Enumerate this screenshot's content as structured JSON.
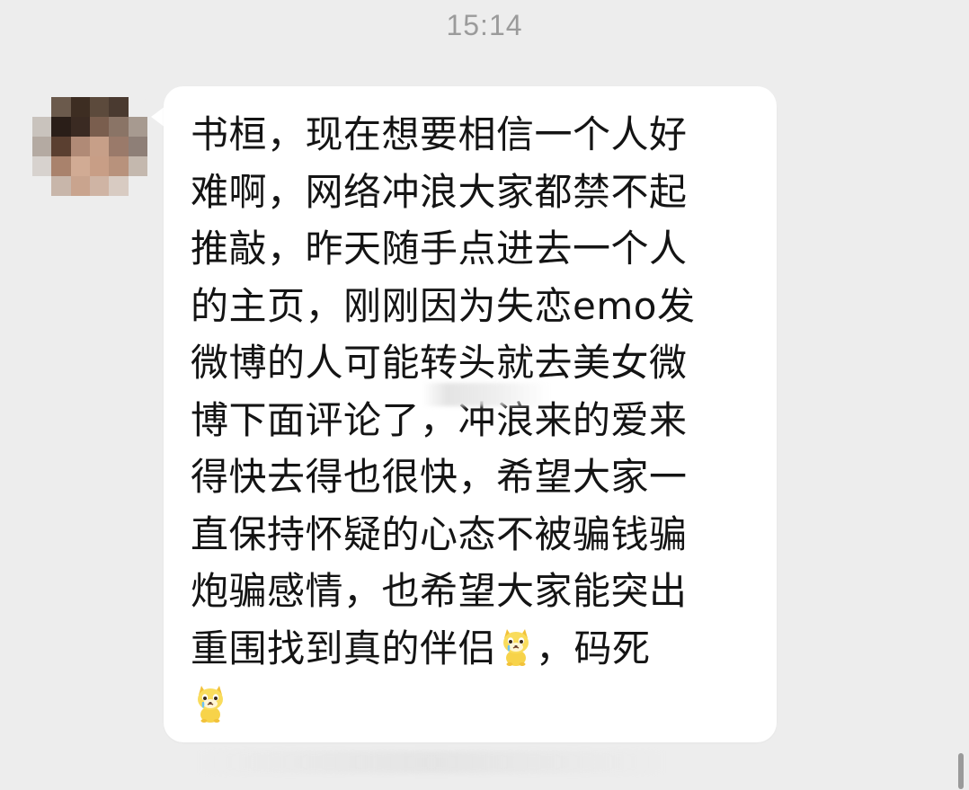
{
  "chat": {
    "timestamp": "15:14",
    "message": {
      "lines": [
        "书桓，现在想要相信一个人好",
        "难啊，网络冲浪大家都禁不起",
        "推敲，昨天随手点进去一个人",
        "的主页，刚刚因为失恋emo发",
        "微博的人可能转头就去美女微",
        "博下面评论了，冲浪来的爱来",
        "得快去得也很快，希望大家一",
        "直保持怀疑的心态不被骗钱骗",
        "炮骗感情，也希望大家能突出"
      ],
      "line10_part1": "重围找到真的伴侣",
      "line10_part2": "，码死",
      "emoji_name": "crying-dog-emoji"
    }
  },
  "colors": {
    "background": "#ededed",
    "bubble": "#ffffff",
    "text": "#141414",
    "timestamp": "#9b9b9b"
  }
}
